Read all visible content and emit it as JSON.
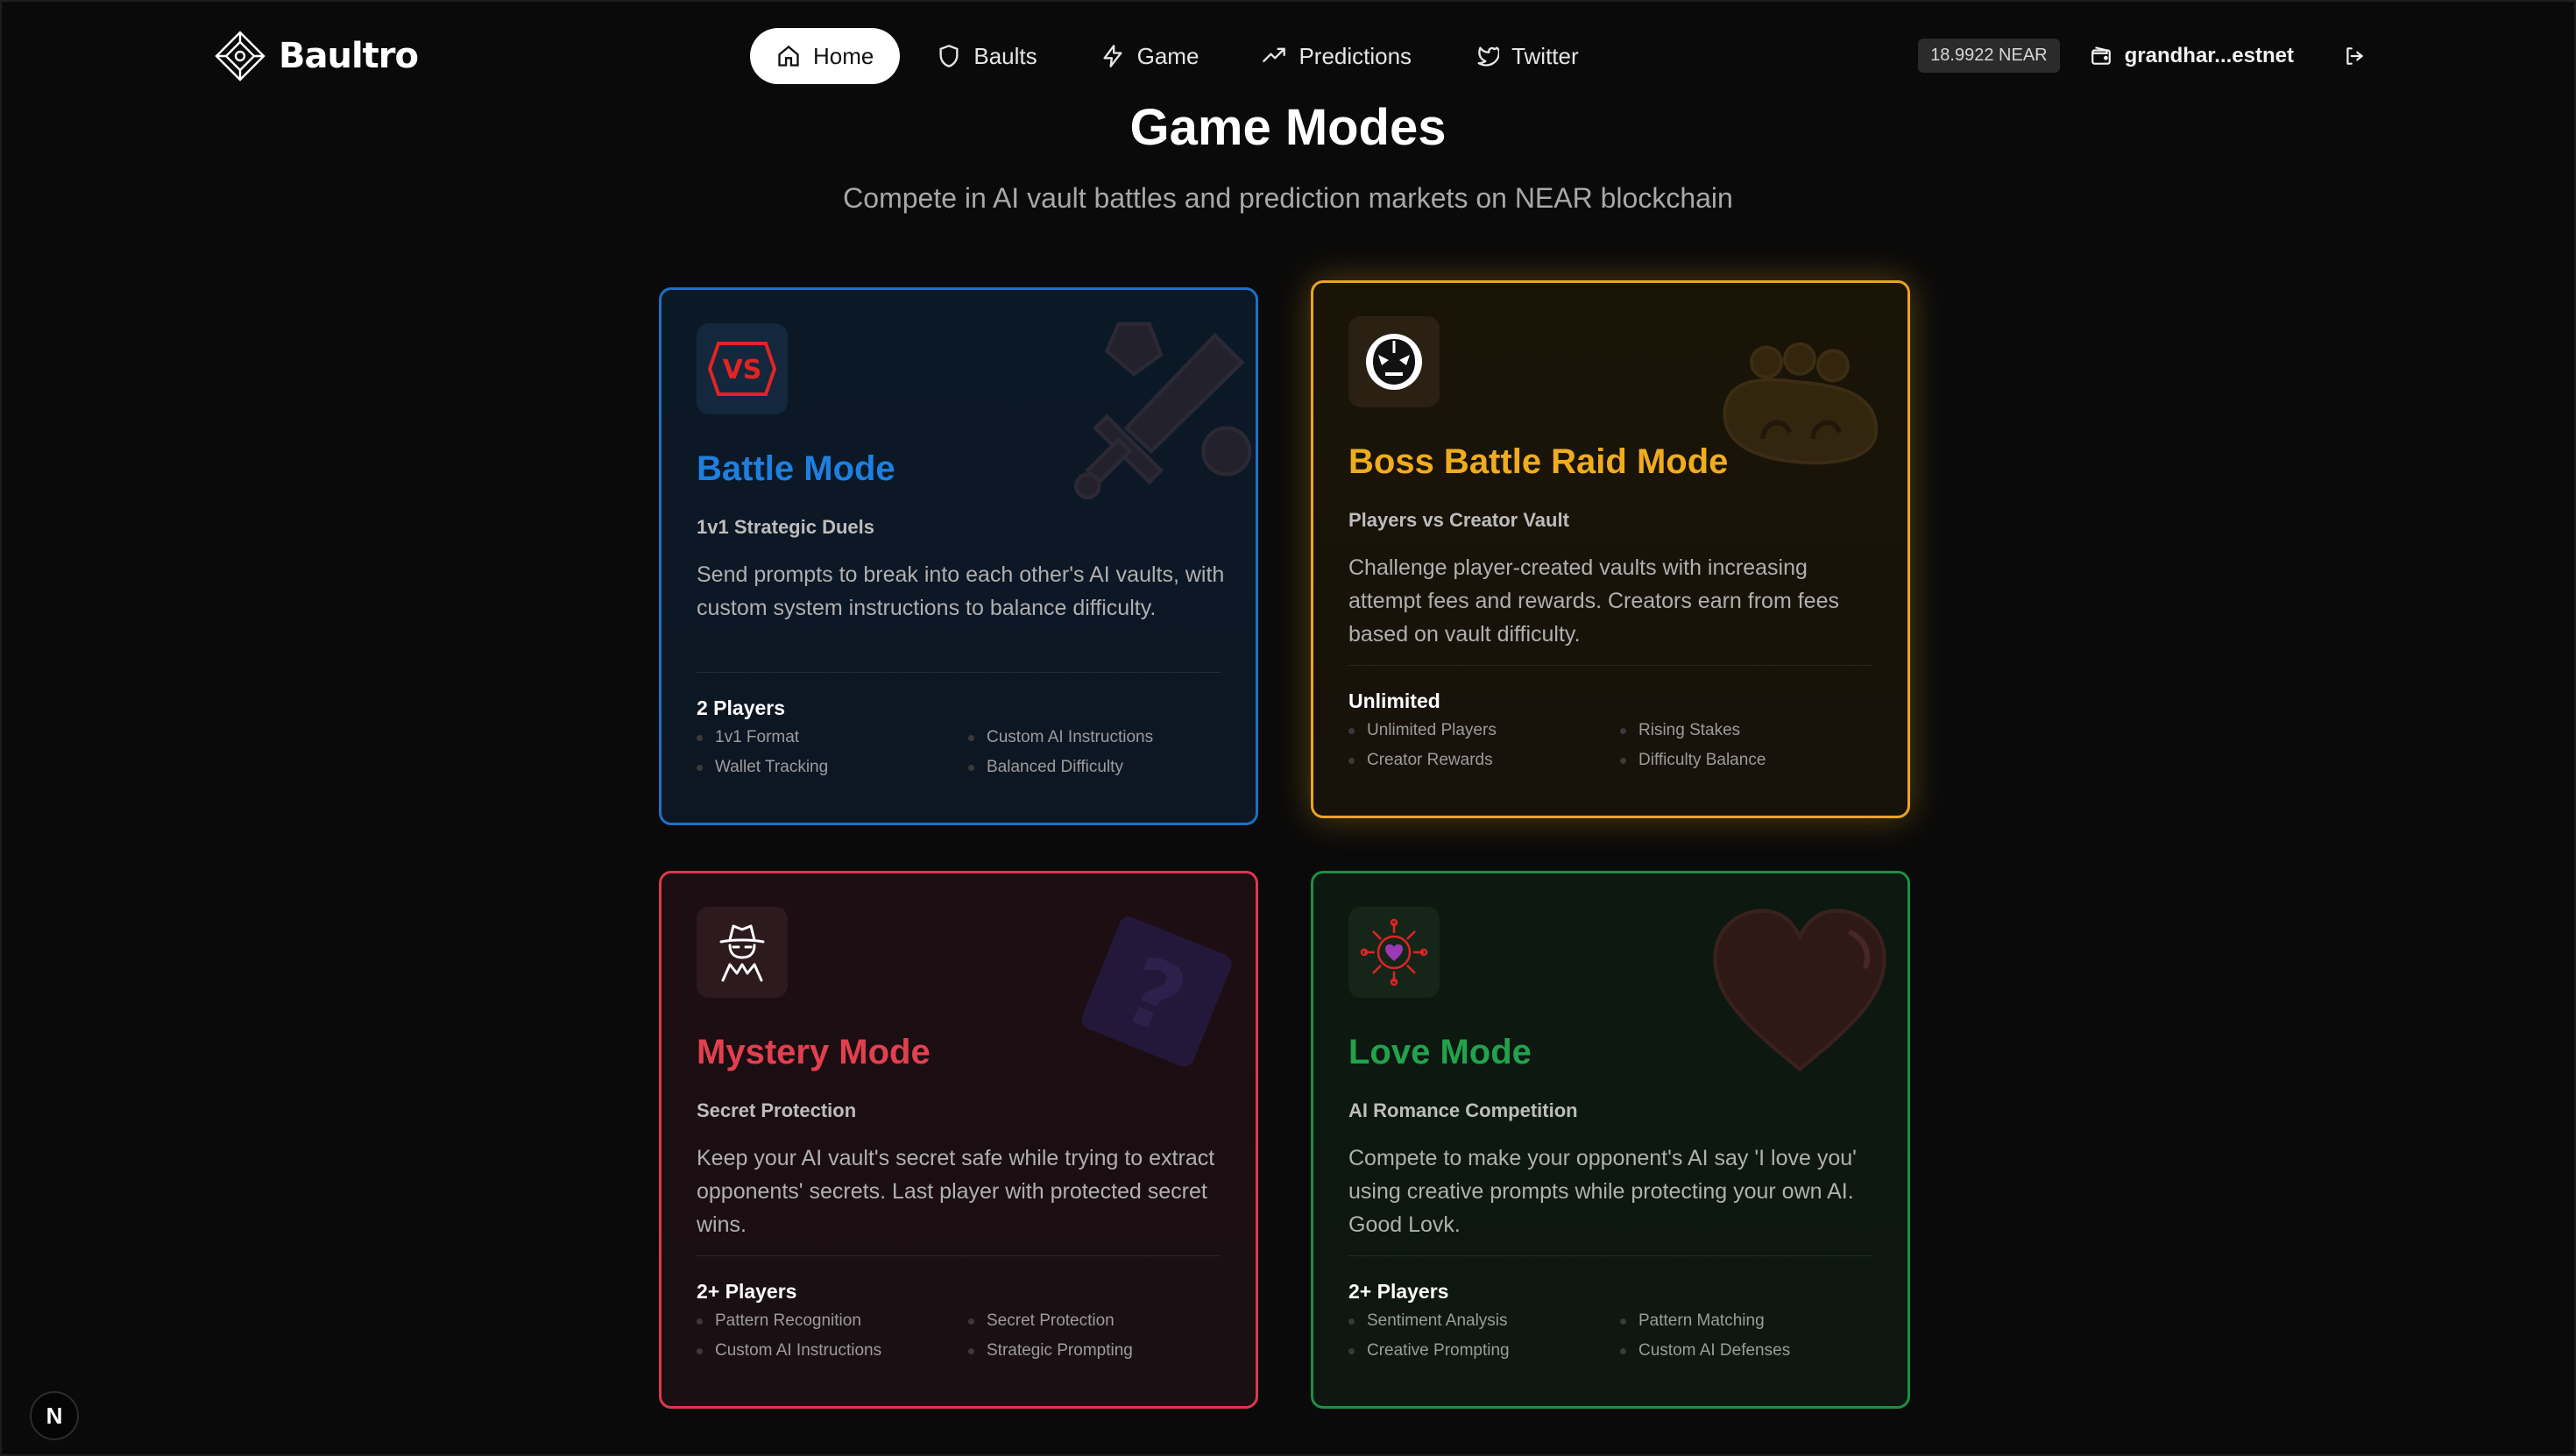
{
  "brand": {
    "name": "Baultro"
  },
  "nav": {
    "items": [
      {
        "label": "Home",
        "icon": "home-icon",
        "active": true
      },
      {
        "label": "Baults",
        "icon": "shield-icon",
        "active": false
      },
      {
        "label": "Game",
        "icon": "lightning-icon",
        "active": false
      },
      {
        "label": "Predictions",
        "icon": "trending-up-icon",
        "active": false
      },
      {
        "label": "Twitter",
        "icon": "twitter-icon",
        "active": false
      }
    ]
  },
  "account": {
    "balance": "18.9922 NEAR",
    "wallet": "grandhar...estnet"
  },
  "hero": {
    "title": "Game Modes",
    "subtitle": "Compete in AI vault battles and prediction markets on NEAR blockchain"
  },
  "cards": [
    {
      "title": "Battle Mode",
      "subtitle": "1v1 Strategic Duels",
      "description": "Send prompts to break into each other's AI vaults, with custom system instructions to balance difficulty.",
      "players": "2 Players",
      "features": [
        "1v1 Format",
        "Custom AI Instructions",
        "Wallet Tracking",
        "Balanced Difficulty"
      ],
      "accent": "#1f6fc2",
      "icon": "vs-icon",
      "decor": "sword-icon"
    },
    {
      "title": "Boss Battle Raid Mode",
      "subtitle": "Players vs Creator Vault",
      "description": "Challenge player-created vaults with increasing attempt fees and rewards. Creators earn from fees based on vault difficulty.",
      "players": "Unlimited",
      "features": [
        "Unlimited Players",
        "Rising Stakes",
        "Creator Rewards",
        "Difficulty Balance"
      ],
      "accent": "#e9a520",
      "icon": "wrestler-mask-icon",
      "decor": "brass-knuckles-icon"
    },
    {
      "title": "Mystery Mode",
      "subtitle": "Secret Protection",
      "description": "Keep your AI vault's secret safe while trying to extract opponents' secrets. Last player with protected secret wins.",
      "players": "2+ Players",
      "features": [
        "Pattern Recognition",
        "Secret Protection",
        "Custom AI Instructions",
        "Strategic Prompting"
      ],
      "accent": "#d9394e",
      "icon": "spy-icon",
      "decor": "question-box-icon"
    },
    {
      "title": "Love Mode",
      "subtitle": "AI Romance Competition",
      "description": "Compete to make your opponent's AI say 'I love you' using creative prompts while protecting your own AI. Good Lovk.",
      "players": "2+ Players",
      "features": [
        "Sentiment Analysis",
        "Pattern Matching",
        "Creative Prompting",
        "Custom AI Defenses"
      ],
      "accent": "#1d8f46",
      "icon": "heart-ornament-icon",
      "decor": "heart-icon"
    }
  ],
  "dev_badge": {
    "label": "N"
  }
}
